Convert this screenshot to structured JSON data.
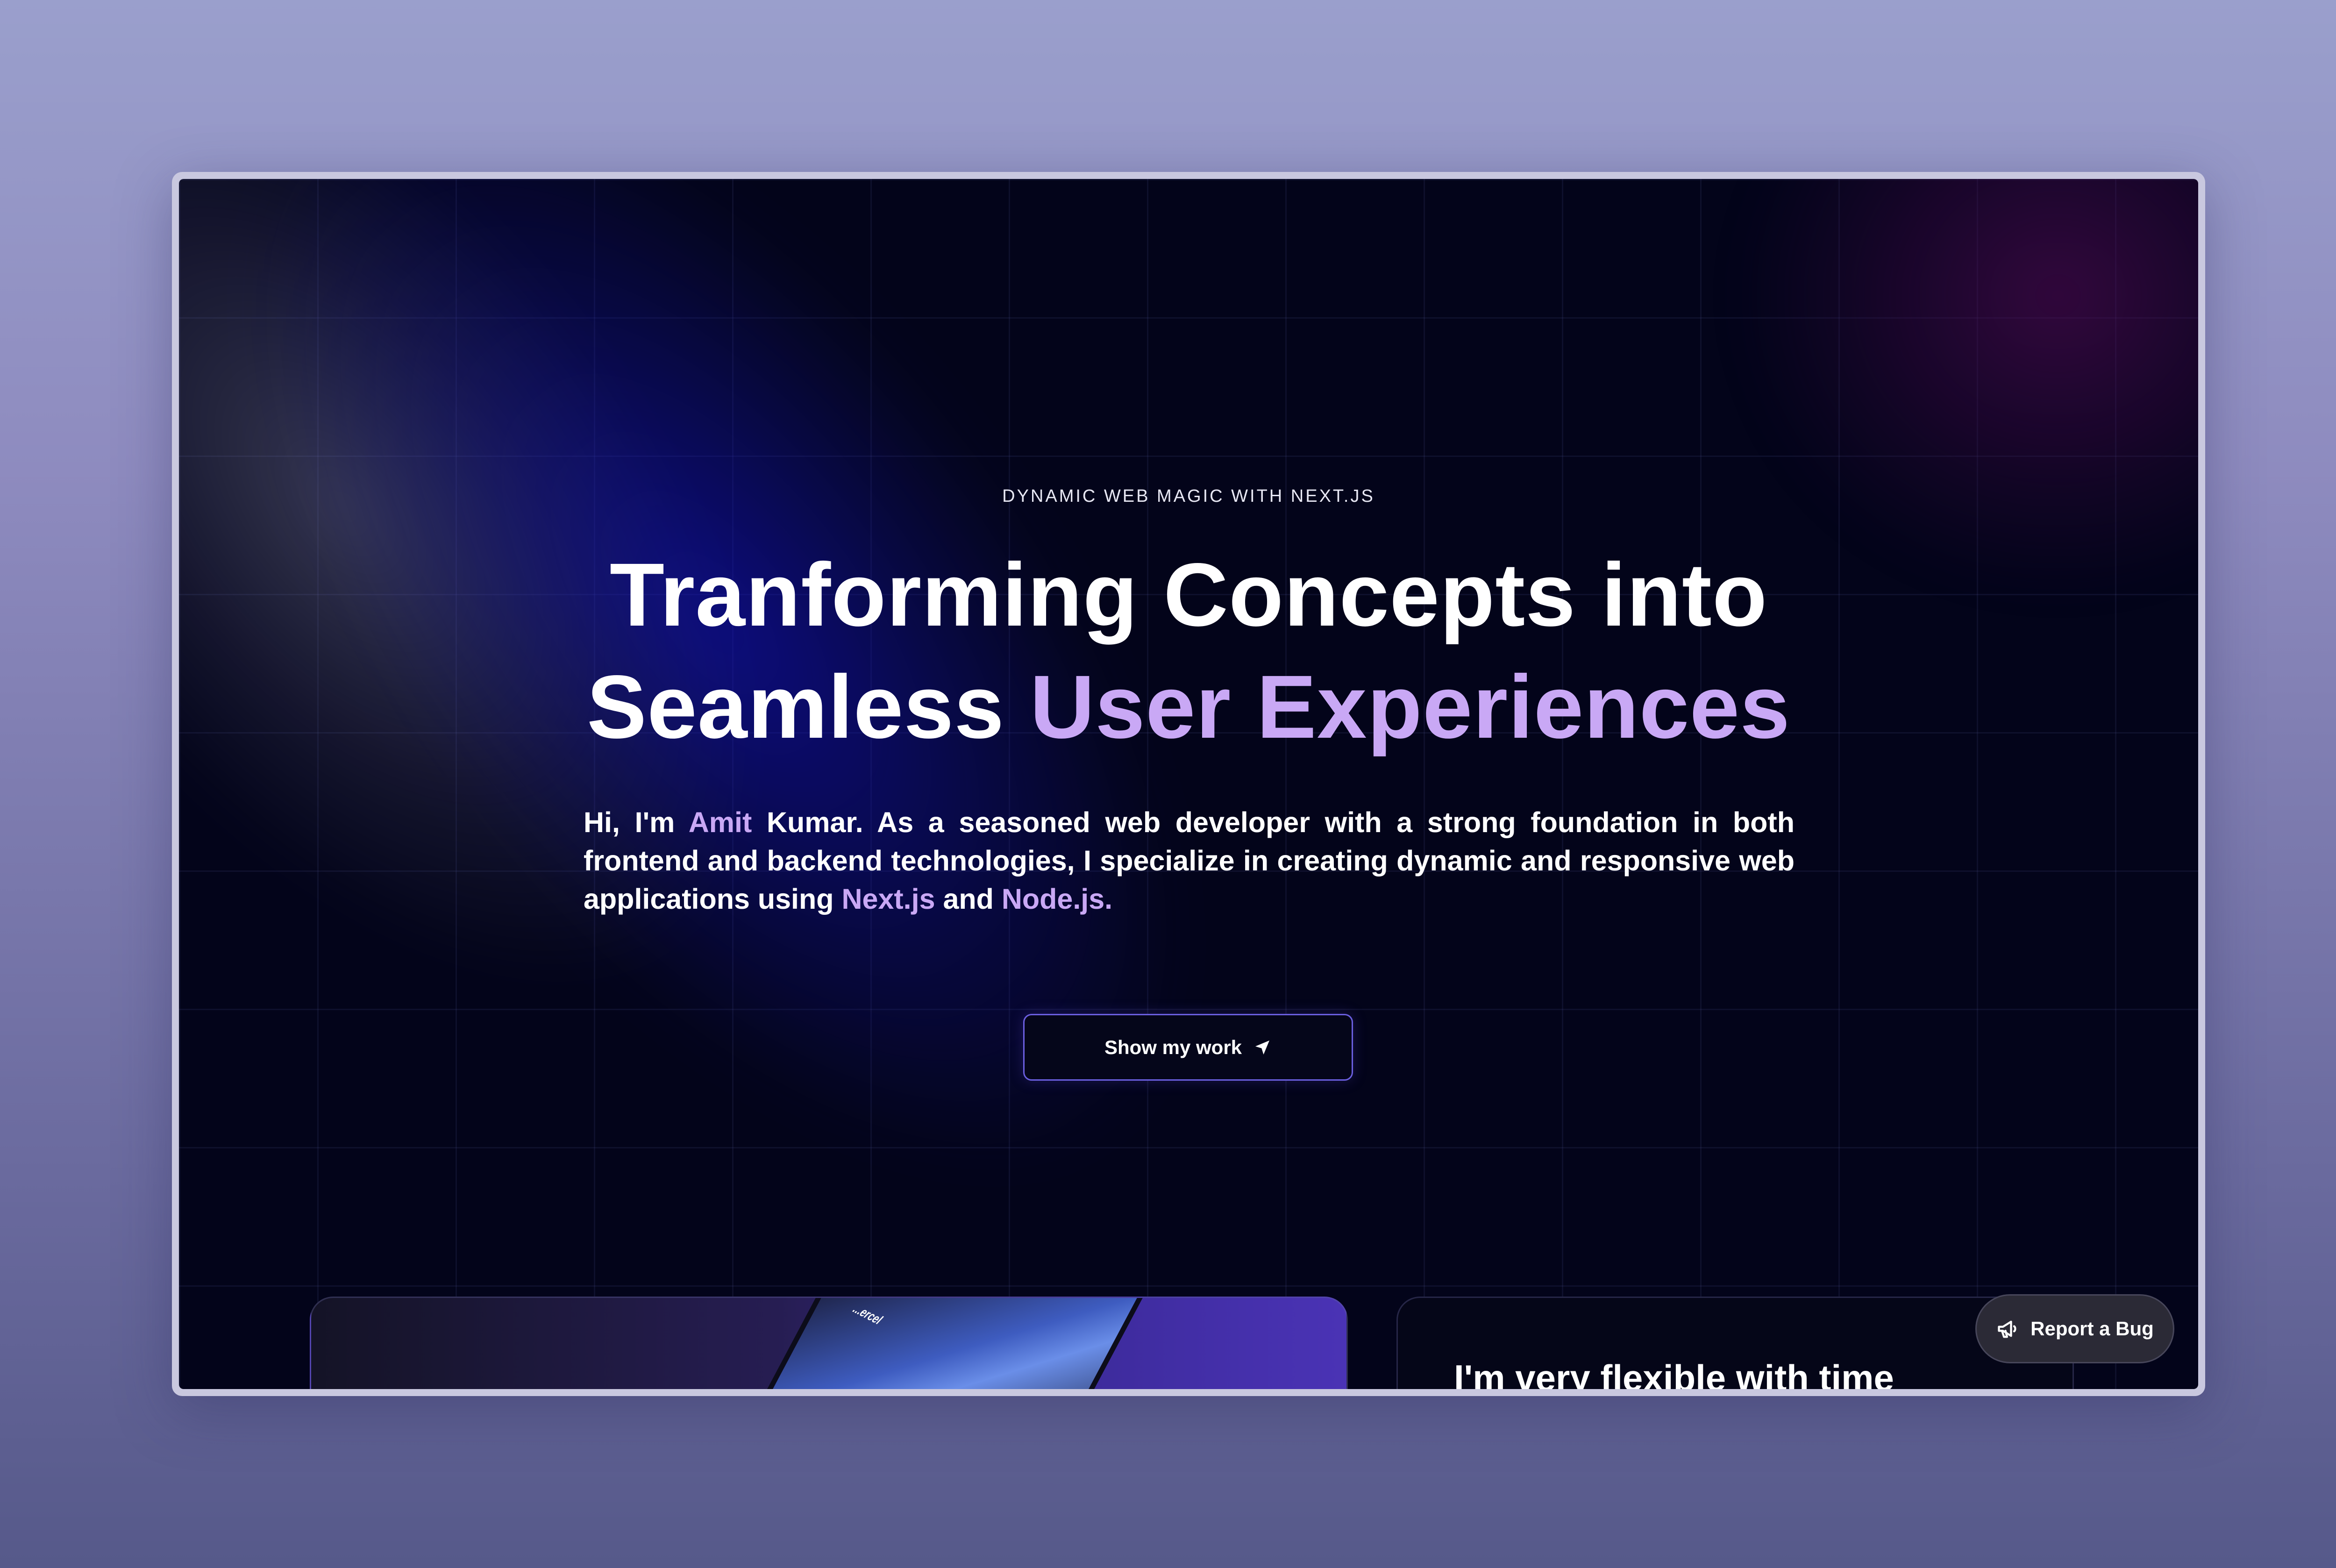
{
  "hero": {
    "eyebrow": "Dynamic Web Magic with Next.js",
    "headline_line1": "Tranforming Concepts into",
    "headline_line2_plain": "Seamless ",
    "headline_line2_accent": "User Experiences",
    "intro": {
      "part1": "Hi, I'm ",
      "name_first": "Amit",
      "part2": " Kumar. As a seasoned web developer with a strong foundation in both frontend and backend technologies, I specialize in creating dynamic and responsive web applications using ",
      "tech1": "Next.js",
      "part3": " and ",
      "tech2": "Node.js."
    },
    "cta_label": "Show my work",
    "cta_icon": "navigation-arrow-icon"
  },
  "cards": {
    "left_device_text": "...ercel",
    "right_title": "I'm very flexible with time"
  },
  "report_bug": {
    "label": "Report a Bug",
    "icon": "megaphone-icon"
  },
  "colors": {
    "accent": "#c9a8f5",
    "background": "#03041a",
    "cta_border": "#6b5fe0"
  }
}
